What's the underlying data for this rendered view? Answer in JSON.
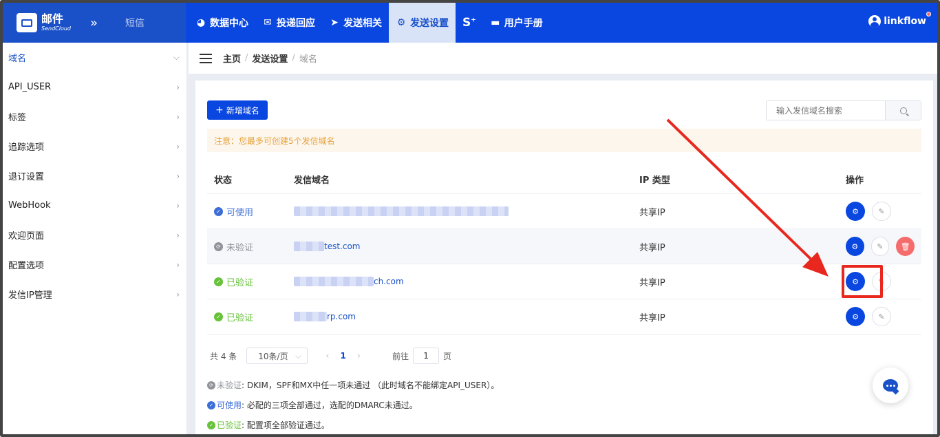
{
  "brand": {
    "name": "邮件",
    "sub": "SendCloud",
    "sms_tab": "短信"
  },
  "nav": [
    {
      "label": "数据中心",
      "icon": "pie-chart-icon"
    },
    {
      "label": "投递回应",
      "icon": "envelope-open-icon"
    },
    {
      "label": "发送相关",
      "icon": "paper-plane-icon"
    },
    {
      "label": "发送设置",
      "icon": "gear-icon",
      "active": true
    },
    {
      "label": "",
      "icon": "s-plus-icon"
    },
    {
      "label": "用户手册",
      "icon": "folder-icon"
    }
  ],
  "user": {
    "name": "linkflow"
  },
  "sidebar": {
    "items": [
      {
        "label": "域名",
        "active": true
      },
      {
        "label": "API_USER"
      },
      {
        "label": "标签"
      },
      {
        "label": "追踪选项"
      },
      {
        "label": "退订设置"
      },
      {
        "label": "WebHook"
      },
      {
        "label": "欢迎页面"
      },
      {
        "label": "配置选项"
      },
      {
        "label": "发信IP管理"
      }
    ]
  },
  "breadcrumb": {
    "home": "主页",
    "section": "发送设置",
    "current": "域名"
  },
  "toolbar": {
    "add_label": "新增域名",
    "search_placeholder": "输入发信域名搜索"
  },
  "notice": "注意：您最多可创建5个发信域名",
  "table": {
    "headers": {
      "status": "状态",
      "domain": "发信域名",
      "ip_type": "IP 类型",
      "ops": "操作"
    },
    "rows": [
      {
        "status": "可使用",
        "status_color": "#3d6ed8",
        "domain_suffix": "",
        "ip": "共享IP"
      },
      {
        "status": "未验证",
        "status_color": "#909399",
        "domain_suffix": "test.com",
        "ip": "共享IP"
      },
      {
        "status": "已验证",
        "status_color": "#67c23a",
        "domain_suffix": "ch.com",
        "ip": "共享IP"
      },
      {
        "status": "已验证",
        "status_color": "#67c23a",
        "domain_suffix": "rp.com",
        "ip": "共享IP"
      }
    ]
  },
  "pager": {
    "total": "共 4 条",
    "page_size": "10条/页",
    "current": "1",
    "goto_prefix": "前往",
    "goto_value": "1",
    "goto_suffix": "页"
  },
  "legend": [
    {
      "term": "未验证",
      "desc": ": DKIM，SPF和MX中任一项未通过 （此时域名不能绑定API_USER）。",
      "color": "#909399"
    },
    {
      "term": "可使用",
      "desc": ": 必配的三项全部通过，选配的DMARC未通过。",
      "color": "#3d6ed8"
    },
    {
      "term": "已验证",
      "desc": ": 配置项全部验证通过。",
      "color": "#67c23a"
    }
  ],
  "colors": {
    "primary": "#0a47e0",
    "annotation": "#e8281e"
  }
}
